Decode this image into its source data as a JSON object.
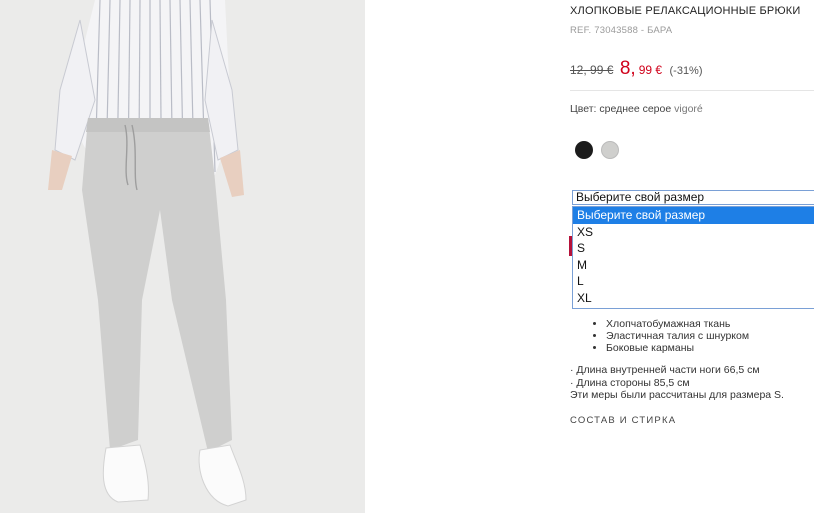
{
  "product": {
    "title": "ХЛОПКОВЫЕ РЕЛАКСАЦИОННЫЕ БРЮКИ",
    "ref": "REF. 73043588 - БАРА",
    "old_price": "12, 99 €",
    "new_price_main": "8,",
    "new_price_cents": "99 €",
    "discount": "(-31%)",
    "color_label": "Цвет:",
    "color_value": "среднее серое",
    "color_name": "vigoré",
    "swatches": [
      {
        "name": "black",
        "color": "#1c1c1c"
      },
      {
        "name": "light-gray",
        "color": "#cfcfcd"
      }
    ]
  },
  "size_select": {
    "current": "Выберите свой размер",
    "options": [
      "Выберите свой размер",
      "XS",
      "S",
      "M",
      "L",
      "XL"
    ],
    "selected_index": 0
  },
  "features": [
    "Хлопчатобумажная ткань",
    "Эластичная талия с шнурком",
    "Боковые карманы"
  ],
  "measurements": {
    "line1": "· Длина внутренней части ноги 66,5 см",
    "line2": "· Длина стороны 85,5 см",
    "line3": "Эти меры были рассчитаны для размера S."
  },
  "care_link": "СОСТАВ И СТИРКА",
  "colors": {
    "price_red": "#d0021b",
    "select_highlight": "#1e7fe6",
    "accent_tab": "#b5123a"
  }
}
